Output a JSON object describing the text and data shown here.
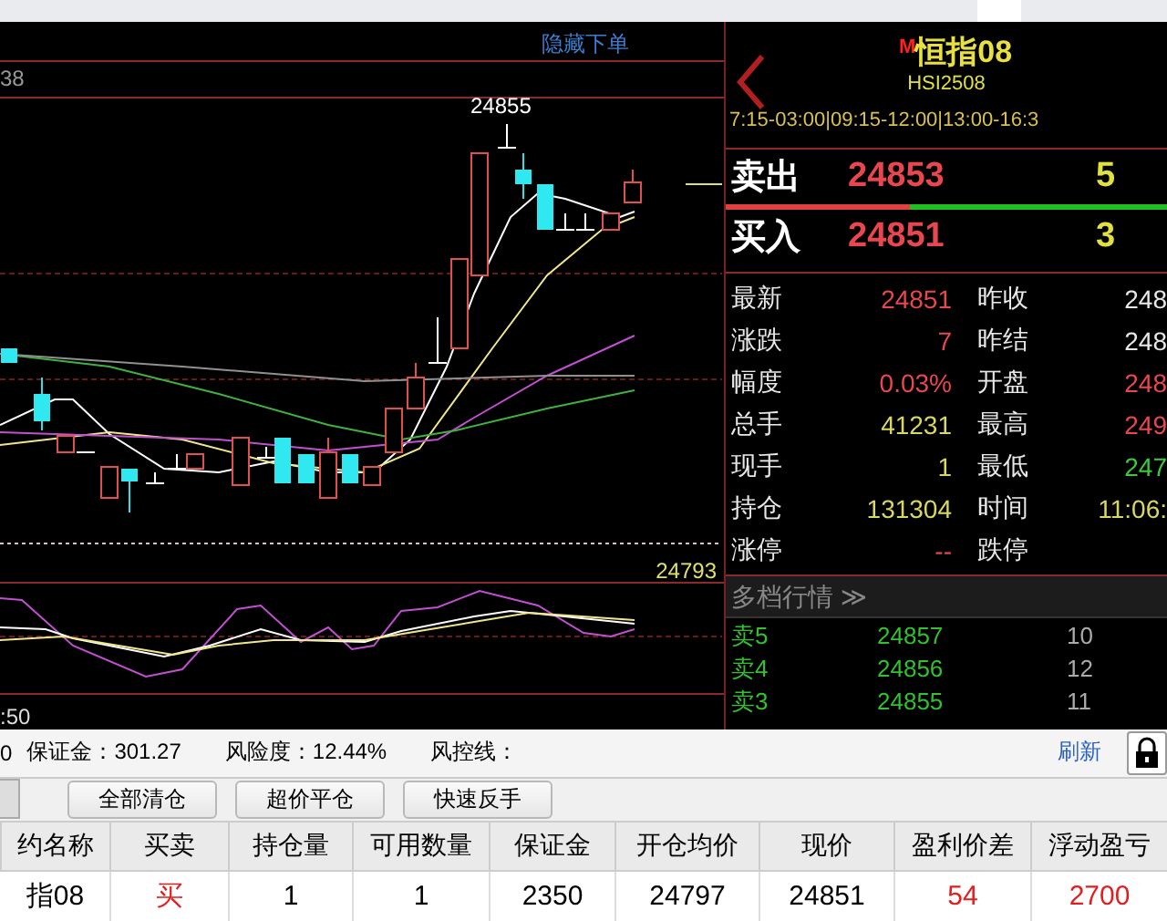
{
  "chart": {
    "hide_order_link": "隐藏下单",
    "top_value": "38",
    "high_label": "24855",
    "price_line_label": "24793",
    "time_label": ":50"
  },
  "quote": {
    "badge": "M",
    "name": "恒指08",
    "code": "HSI2508",
    "sessions": "7:15-03:00|09:15-12:00|13:00-16:3",
    "ask": {
      "label": "卖出",
      "price": "24853",
      "volume": "5"
    },
    "bid": {
      "label": "买入",
      "price": "24851",
      "volume": "3"
    },
    "stats": [
      {
        "label": "最新",
        "value": "24851",
        "kind": "up"
      },
      {
        "label": "昨收",
        "value": "248",
        "kind": "flat"
      },
      {
        "label": "涨跌",
        "value": "7",
        "kind": "up"
      },
      {
        "label": "昨结",
        "value": "248",
        "kind": "flat"
      },
      {
        "label": "幅度",
        "value": "0.03%",
        "kind": "up"
      },
      {
        "label": "开盘",
        "value": "248",
        "kind": "up"
      },
      {
        "label": "总手",
        "value": "41231",
        "kind": "volume"
      },
      {
        "label": "最高",
        "value": "249",
        "kind": "up"
      },
      {
        "label": "现手",
        "value": "1",
        "kind": "volume"
      },
      {
        "label": "最低",
        "value": "247",
        "kind": "down"
      },
      {
        "label": "持仓",
        "value": "131304",
        "kind": "volume"
      },
      {
        "label": "时间",
        "value": "11:06:",
        "kind": "volume"
      },
      {
        "label": "涨停",
        "value": "--",
        "kind": "up"
      },
      {
        "label": "跌停"
      }
    ],
    "depth_title": "多档行情 ≫",
    "depth": [
      {
        "label": "卖5",
        "price": "24857",
        "volume": "10"
      },
      {
        "label": "卖4",
        "price": "24856",
        "volume": "12"
      },
      {
        "label": "卖3",
        "price": "24855",
        "volume": "11"
      }
    ]
  },
  "account": {
    "prefix": "0",
    "margin": "保证金：301.27",
    "risk": "风险度：12.44%",
    "risk_line": "风控线：",
    "refresh": "刷新"
  },
  "actions": [
    "全部清仓",
    "超价平仓",
    "快速反手"
  ],
  "table": {
    "columns": [
      "约名称",
      "买卖",
      "持仓量",
      "可用数量",
      "保证金",
      "开仓均价",
      "现价",
      "盈利价差",
      "浮动盈亏"
    ],
    "rows": [
      {
        "cells": [
          {
            "text": "指08",
            "kind": "plain"
          },
          {
            "text": "买",
            "kind": "up"
          },
          {
            "text": "1",
            "kind": "plain"
          },
          {
            "text": "1",
            "kind": "plain"
          },
          {
            "text": "2350",
            "kind": "plain"
          },
          {
            "text": "24797",
            "kind": "plain"
          },
          {
            "text": "24851",
            "kind": "plain"
          },
          {
            "text": "54",
            "kind": "up"
          },
          {
            "text": "2700",
            "kind": "up"
          }
        ]
      }
    ]
  }
}
